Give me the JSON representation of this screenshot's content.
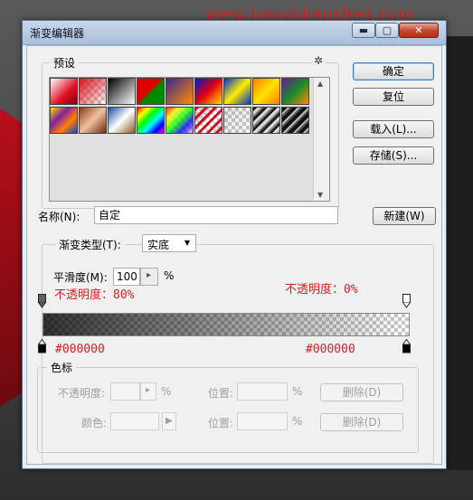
{
  "watermark": "www.baoyidiansheji.com",
  "window": {
    "title": "渐变编辑器",
    "minimize_glyph": "▬",
    "maximize_glyph": "▢",
    "close_glyph": "✕"
  },
  "presets": {
    "title": "预设",
    "gear_glyph": "✲",
    "scroll_up_glyph": "▲",
    "scroll_down_glyph": "▼",
    "swatches": [
      {
        "name": "white-red"
      },
      {
        "name": "red-transparent"
      },
      {
        "name": "black-white"
      },
      {
        "name": "red-green"
      },
      {
        "name": "violet-orange"
      },
      {
        "name": "blue-red-yellow"
      },
      {
        "name": "blue-yellow-blue"
      },
      {
        "name": "orange-yellow-orange"
      },
      {
        "name": "violet-green-orange"
      },
      {
        "name": "yellow-violet-orange-blue"
      },
      {
        "name": "copper"
      },
      {
        "name": "chrome"
      },
      {
        "name": "spectrum"
      },
      {
        "name": "transparent-rainbow"
      },
      {
        "name": "transparent-stripes"
      },
      {
        "name": "transparent-checker"
      },
      {
        "name": "silver-stripes"
      },
      {
        "name": "black-stripes"
      }
    ]
  },
  "buttons": {
    "ok": "确定",
    "reset": "复位",
    "load": "载入(L)...",
    "save": "存储(S)...",
    "new": "新建(W)"
  },
  "name_field": {
    "label": "名称(N):",
    "value": "自定"
  },
  "gradient_type": {
    "label": "渐变类型(T):",
    "value": "实底",
    "arrow_glyph": "▼"
  },
  "smoothness": {
    "label": "平滑度(M):",
    "value": "100",
    "arrow_glyph": "▸",
    "unit": "%"
  },
  "annotations": {
    "left_opacity": "不透明度：80%",
    "right_opacity": "不透明度：0%",
    "left_color": "#000000",
    "right_color": "#000000"
  },
  "color_stops": {
    "title": "色标",
    "opacity_label": "不透明度:",
    "opacity_arrow": "▸",
    "opacity_unit": "%",
    "location_label_1": "位置:",
    "location_unit_1": "%",
    "delete_label_1": "删除(D)",
    "color_label": "颜色:",
    "color_arrow": "▶",
    "location_label_2": "位置:",
    "location_unit_2": "%",
    "delete_label_2": "删除(D)"
  },
  "colors": {
    "accent_red": "#d21e1e",
    "stop_color": "#000000"
  }
}
